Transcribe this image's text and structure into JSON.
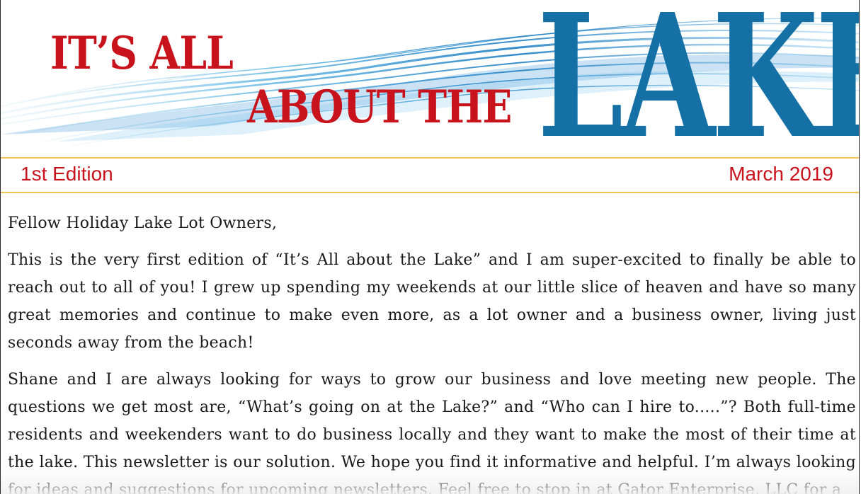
{
  "masthead": {
    "line1": "IT’S ALL",
    "line2": "ABOUT THE",
    "line3": "LAKE",
    "title_red": "#c8131c",
    "title_blue": "#1570a6"
  },
  "edition_bar": {
    "edition": "1st Edition",
    "date": "March 2019",
    "rule_color": "#f0c24f"
  },
  "letter": {
    "salutation": "Fellow Holiday Lake Lot Owners,",
    "paragraph1": "This is the very first edition of “It’s All about the Lake” and I am super-excited to finally be able to reach out to all of you!  I grew up spending my weekends at our little slice of heaven and have so many great memories and continue to make even more, as a lot owner and a business owner, living just seconds away from the beach!",
    "paragraph2": "Shane and I are always looking for ways to grow our business and love meeting new people.  The questions we get most are, “What’s going on at the Lake?” and “Who can I hire to.....”? Both full-time residents and weekenders want to do business locally and they want to make the most of their time at the lake. This newsletter is our solution. We hope you find it informative and helpful. I’m always looking for ideas and suggestions for upcoming newsletters. Feel free to stop in at Gator Enterprise, LLC for a"
  }
}
